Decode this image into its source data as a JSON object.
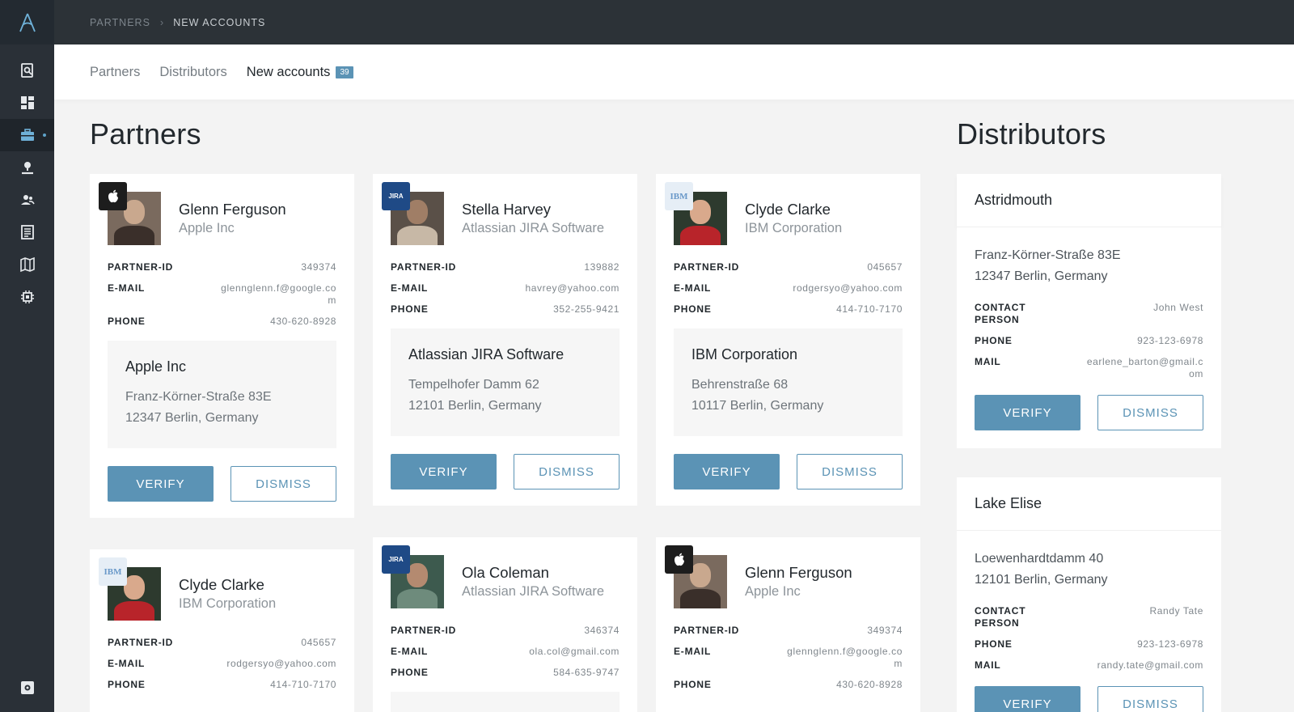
{
  "breadcrumb": {
    "items": [
      "PARTNERS",
      "NEW ACCOUNTS"
    ]
  },
  "tabs": [
    {
      "label": "Partners"
    },
    {
      "label": "Distributors"
    },
    {
      "label": "New accounts",
      "badge": "39"
    }
  ],
  "sections": {
    "partners_title": "Partners",
    "distributors_title": "Distributors"
  },
  "labels": {
    "partner_id": "PARTNER-ID",
    "email": "E-MAIL",
    "phone": "PHONE",
    "contact_person": "CONTACT PERSON",
    "mail": "MAIL",
    "verify": "VERIFY",
    "dismiss": "DISMISS"
  },
  "partners": [
    {
      "name": "Glenn Ferguson",
      "company": "Apple Inc",
      "brand": "apple-icon",
      "partner_id": "349374",
      "email": "glennglenn.f@google.com",
      "phone": "430-620-8928",
      "address_title": "Apple Inc",
      "address_lines": [
        "Franz-Körner-Straße 83E",
        "12347 Berlin, Germany"
      ]
    },
    {
      "name": "Stella Harvey",
      "company": "Atlassian JIRA Software",
      "brand": "jira-icon",
      "partner_id": "139882",
      "email": "havrey@yahoo.com",
      "phone": "352-255-9421",
      "address_title": "Atlassian JIRA Software",
      "address_lines": [
        "Tempelhofer Damm 62",
        "12101 Berlin, Germany"
      ]
    },
    {
      "name": "Clyde Clarke",
      "company": "IBM Corporation",
      "brand": "ibm-icon",
      "partner_id": "045657",
      "email": "rodgersyo@yahoo.com",
      "phone": "414-710-7170",
      "address_title": "IBM Corporation",
      "address_lines": [
        "Behrenstraße 68",
        "10117 Berlin, Germany"
      ]
    },
    {
      "name": "Clyde Clarke",
      "company": "IBM Corporation",
      "brand": "ibm-icon",
      "partner_id": "045657",
      "email": "rodgersyo@yahoo.com",
      "phone": "414-710-7170"
    },
    {
      "name": "Ola Coleman",
      "company": "Atlassian JIRA Software",
      "brand": "jira-icon",
      "partner_id": "346374",
      "email": "ola.col@gmail.com",
      "phone": "584-635-9747"
    },
    {
      "name": "Glenn Ferguson",
      "company": "Apple Inc",
      "brand": "apple-icon",
      "partner_id": "349374",
      "email": "glennglenn.f@google.com",
      "phone": "430-620-8928"
    }
  ],
  "brand_text": {
    "jira": "JIRA",
    "ibm": "IBM"
  },
  "distributors": [
    {
      "name": "Astridmouth",
      "address_lines": [
        "Franz-Körner-Straße 83E",
        "12347 Berlin, Germany"
      ],
      "contact_person": "John West",
      "phone": "923-123-6978",
      "mail": "earlene_barton@gmail.com"
    },
    {
      "name": "Lake Elise",
      "address_lines": [
        "Loewenhardtdamm 40",
        "12101 Berlin, Germany"
      ],
      "contact_person": "Randy Tate",
      "phone": "923-123-6978",
      "mail": "randy.tate@gmail.com"
    }
  ],
  "colors": {
    "accent": "#5b93b5",
    "sidebar": "#2a3037",
    "topbar": "#2c3237"
  }
}
